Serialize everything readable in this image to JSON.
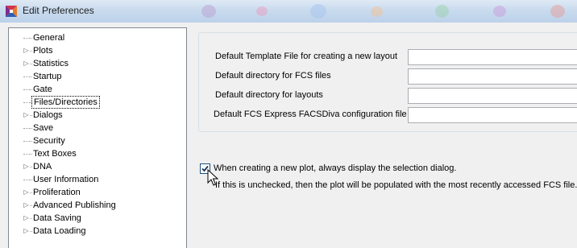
{
  "window": {
    "title": "Edit Preferences",
    "icon": "flow-cytometry-app-icon"
  },
  "tree": {
    "items": [
      {
        "label": "General",
        "expandable": false,
        "selected": false
      },
      {
        "label": "Plots",
        "expandable": true,
        "selected": false
      },
      {
        "label": "Statistics",
        "expandable": true,
        "selected": false
      },
      {
        "label": "Startup",
        "expandable": false,
        "selected": false
      },
      {
        "label": "Gate",
        "expandable": false,
        "selected": false
      },
      {
        "label": "Files/Directories",
        "expandable": false,
        "selected": true
      },
      {
        "label": "Dialogs",
        "expandable": true,
        "selected": false
      },
      {
        "label": "Save",
        "expandable": false,
        "selected": false
      },
      {
        "label": "Security",
        "expandable": false,
        "selected": false
      },
      {
        "label": "Text Boxes",
        "expandable": false,
        "selected": false
      },
      {
        "label": "DNA",
        "expandable": true,
        "selected": false
      },
      {
        "label": "User Information",
        "expandable": false,
        "selected": false
      },
      {
        "label": "Proliferation",
        "expandable": true,
        "selected": false
      },
      {
        "label": "Advanced Publishing",
        "expandable": true,
        "selected": false
      },
      {
        "label": "Data Saving",
        "expandable": true,
        "selected": false
      },
      {
        "label": "Data Loading",
        "expandable": true,
        "selected": false
      }
    ]
  },
  "files": {
    "rows": [
      {
        "label": "Default Template File for creating a new layout",
        "value": ""
      },
      {
        "label": "Default directory for FCS files",
        "value": ""
      },
      {
        "label": "Default directory for layouts",
        "value": ""
      },
      {
        "label": "Default FCS Express FACSDiva configuration file",
        "value": ""
      }
    ]
  },
  "plot_dialog": {
    "checked": true,
    "label": "When creating a new plot, always display the selection dialog.",
    "info": "If this is unchecked, then the plot will be populated with the most recently accessed FCS file."
  },
  "colors": {
    "title_bar": "#c9dbee",
    "selection_border": "#000000",
    "checkbox_border": "#1c5180"
  }
}
